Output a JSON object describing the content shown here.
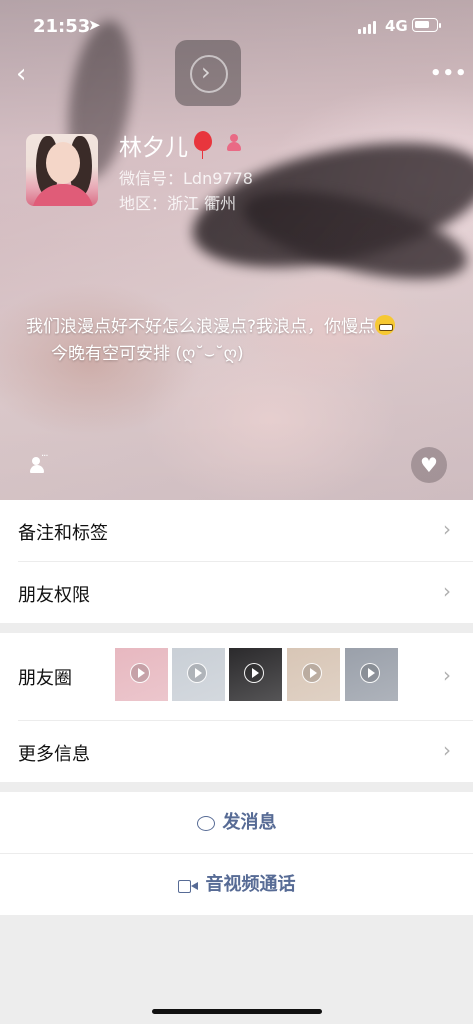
{
  "status_bar": {
    "time": "21:53",
    "network": "4G",
    "battery_level": 0.75
  },
  "profile": {
    "name": "林夕儿",
    "wechat_id": "微信号：Ldn9778",
    "region": "地区：浙江 衢州",
    "signature_line1": "我们浪漫点好不好怎么浪漫点?我浪点，你慢点",
    "signature_line2": "今晚有空可安排 (ღ˘⌣˘ღ)"
  },
  "menu": {
    "remarks_tags": "备注和标签",
    "friend_permissions": "朋友权限",
    "moments": "朋友圈",
    "more_info": "更多信息"
  },
  "moments_thumbs": [
    {
      "name": "moment-thumb-1",
      "color": "#e7b8c0"
    },
    {
      "name": "moment-thumb-2",
      "color": "#c9cfd6"
    },
    {
      "name": "moment-thumb-3",
      "color": "#2b2a2c"
    },
    {
      "name": "moment-thumb-4",
      "color": "#d8c6b6"
    },
    {
      "name": "moment-thumb-5",
      "color": "#9aa0aa"
    }
  ],
  "actions": {
    "send_message": "发消息",
    "video_call": "音视频通话"
  },
  "colors": {
    "link_blue": "#576b95",
    "page_bg": "#ededed"
  },
  "icons": [
    "location-arrow-icon",
    "back-chevron-icon",
    "more-dots-icon",
    "play-circle-icon",
    "balloon-icon",
    "female-gender-icon",
    "grin-emoji-icon",
    "status-person-icon",
    "heart-icon",
    "chevron-right-icon",
    "message-bubble-icon",
    "video-camera-icon"
  ]
}
